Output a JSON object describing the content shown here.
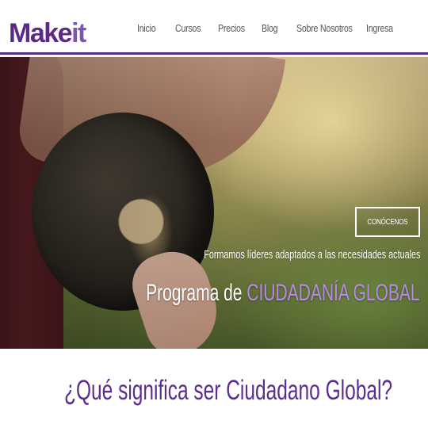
{
  "brand": {
    "logo_make": "Make",
    "logo_it": "it",
    "accent_color": "#5b2a86"
  },
  "nav": {
    "items": [
      {
        "label": "Inicio"
      },
      {
        "label": "Cursos"
      },
      {
        "label": "Precios"
      },
      {
        "label": "Blog"
      },
      {
        "label": "Sobre Nosotros"
      },
      {
        "label": "Ingresa"
      }
    ]
  },
  "hero": {
    "cta_label": "CONÓCENOS",
    "subtitle": "Formamos líderes adaptados a las necesidades actuales",
    "title_prefix": "Programa de",
    "title_highlight": "CIUDADANÍA GLOBAL",
    "highlight_color": "#b68ae6"
  },
  "section": {
    "heading": "¿Qué significa ser Ciudadano Global?",
    "heading_color": "#5a2d91"
  }
}
